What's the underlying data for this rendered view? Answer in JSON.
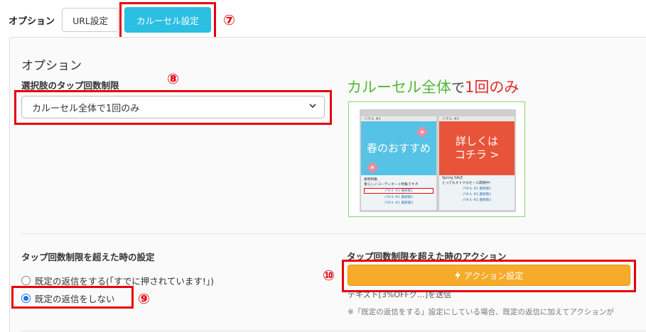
{
  "options_bar": {
    "label": "オプション",
    "tab_url": "URL設定",
    "tab_carousel": "カルーセル設定",
    "marker": "⑦"
  },
  "panel": {
    "title": "オプション",
    "tap_limit": {
      "label": "選択肢のタップ回数制限",
      "marker": "⑧",
      "selected": "カルーセル全体で1回のみ"
    },
    "preview": {
      "heading_part1": "カルーセル全体",
      "heading_part2": "で",
      "heading_part3": "1回のみ",
      "card1": {
        "header": "パネル #1",
        "image_text": "春のおすすめ",
        "title": "春物特集",
        "desc": "春らしいコーディネート特集です♬",
        "options": [
          "パネル #1 選択肢1",
          "パネル #1 選択肢2",
          "パネル #1 選択肢3"
        ]
      },
      "card2": {
        "header": "パネル #2",
        "image_text": "詳しくは コチラ >",
        "title": "Spring SALE",
        "desc": "とってもオトクなセール開催中！",
        "options": [
          "パネル #2 選択肢1",
          "パネル #2 選択肢2",
          "パネル #2 選択肢3"
        ]
      }
    },
    "over_limit": {
      "label": "タップ回数制限を超えた時の設定",
      "radio1": "既定の返信をする(「すでに押されています!」)",
      "radio2": "既定の返信をしない",
      "marker": "⑨",
      "selected_index": 2
    },
    "over_action": {
      "label": "タップ回数制限を超えた時のアクション",
      "marker": "⑩",
      "button": "アクション設定",
      "action_text": "テキスト[3%OFFク…]を送信",
      "note": "※「既定の返信をする」設定にしている場合、既定の返信に加えてアクションが"
    }
  },
  "colors": {
    "accent_tab": "#2bbfe2",
    "highlight_red": "#e8000b",
    "action_orange": "#f7ab2a",
    "heading_green": "#52b934"
  }
}
